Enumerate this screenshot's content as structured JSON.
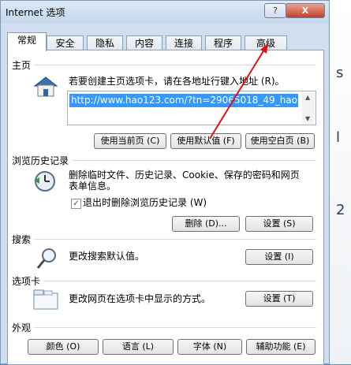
{
  "window": {
    "title": "Internet 选项",
    "help_glyph": "?",
    "close_glyph": "X"
  },
  "tabs": [
    {
      "label": "常规",
      "active": true
    },
    {
      "label": "安全"
    },
    {
      "label": "隐私"
    },
    {
      "label": "内容"
    },
    {
      "label": "连接"
    },
    {
      "label": "程序"
    },
    {
      "label": "高级"
    }
  ],
  "homepage": {
    "section": "主页",
    "description": "若要创建主页选项卡，请在各地址行键入地址 (R)。",
    "url": "http://www.hao123.com/?tn=29065018_49_hao",
    "btn_current": "使用当前页 (C)",
    "btn_default": "使用默认值 (F)",
    "btn_blank": "使用空白页 (B)"
  },
  "history": {
    "section": "浏览历史记录",
    "description_line1": "删除临时文件、历史记录、Cookie、保存的密码和网页",
    "description_line2": "表单信息。",
    "checkbox_label": "退出时删除浏览历史记录 (W)",
    "checkbox_checked": true,
    "btn_delete": "删除 (D)...",
    "btn_settings": "设置 (S)"
  },
  "search": {
    "section": "搜索",
    "description": "更改搜索默认值。",
    "btn_settings": "设置 (I)"
  },
  "tabs_section": {
    "section": "选项卡",
    "description": "更改网页在选项卡中显示的方式。",
    "btn_settings": "设置 (T)"
  },
  "appearance": {
    "section": "外观",
    "btn_colors": "颜色 (O)",
    "btn_languages": "语言 (L)",
    "btn_fonts": "字体 (N)",
    "btn_accessibility": "辅助功能 (E)"
  },
  "background_glyphs": [
    "s",
    "l",
    "2"
  ],
  "colors": {
    "selection": "#3399ff",
    "arrow": "#e01010",
    "close": "#c6402a"
  },
  "icons": [
    "house-icon",
    "history-icon",
    "magnifier-icon",
    "tabs-icon",
    "red-arrow-annotation"
  ]
}
